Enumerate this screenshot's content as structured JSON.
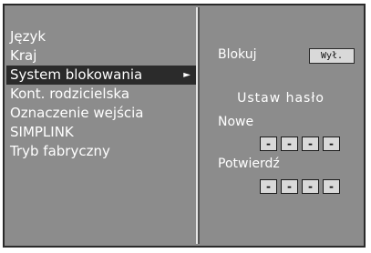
{
  "menu": {
    "items": [
      {
        "label": "Język"
      },
      {
        "label": "Kraj"
      },
      {
        "label": "System blokowania",
        "selected": true
      },
      {
        "label": "Kont. rodzicielska"
      },
      {
        "label": "Oznaczenie wejścia"
      },
      {
        "label": "SIMPLINK"
      },
      {
        "label": "Tryb fabryczny"
      }
    ],
    "arrow": "►"
  },
  "lock": {
    "label": "Blokuj",
    "value": "Wył."
  },
  "password": {
    "title": "Ustaw hasło",
    "new_label": "Nowe",
    "confirm_label": "Potwierdź",
    "new_digits": [
      "-",
      "-",
      "-",
      "-"
    ],
    "confirm_digits": [
      "-",
      "-",
      "-",
      "-"
    ]
  },
  "colors": {
    "panel_bg": "#8c8c8c",
    "selected_bg": "#2b2b2b",
    "field_bg": "#d9d9d9",
    "text": "#ffffff"
  }
}
